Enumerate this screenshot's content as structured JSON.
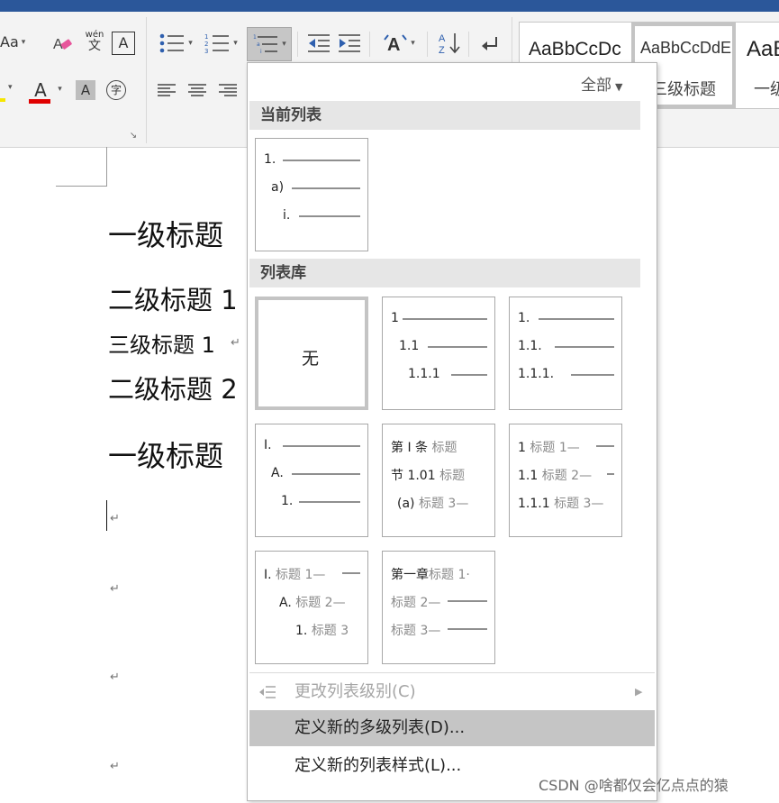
{
  "ribbon": {
    "font_case_label": "Aa",
    "phonetic_top": "wén",
    "phonetic_bottom": "文",
    "char_border_label": "A",
    "font_color_label": "A",
    "char_shading_label": "A",
    "enclose_char_label": "字",
    "dialog_launcher": "↘",
    "styles": [
      {
        "sample": "AaBbCcDc",
        "name": ""
      },
      {
        "sample": "AaBbCcDdE",
        "name": "三级标题"
      },
      {
        "sample": "AaB",
        "name": "一级"
      }
    ]
  },
  "document": {
    "headings": [
      "一级标题",
      "二级标题 1",
      "三级标题 1",
      "二级标题 2",
      "一级标题"
    ],
    "para_mark": "↵"
  },
  "dropdown": {
    "filter_label": "全部",
    "current_list_header": "当前列表",
    "library_header": "列表库",
    "current_list": [
      "1.",
      "a)",
      "i."
    ],
    "none_label": "无",
    "lib": {
      "t2": [
        "1",
        "1.1",
        "1.1.1"
      ],
      "t3": [
        "1.",
        "1.1.",
        "1.1.1."
      ],
      "t4": [
        "I.",
        "A.",
        "1."
      ],
      "t5": [
        {
          "prefix": "第 Ⅰ 条",
          "text": "标题"
        },
        {
          "prefix": "节 1.01",
          "text": "标题"
        },
        {
          "prefix": "(a)",
          "text": "标题 3—"
        }
      ],
      "t6": [
        {
          "prefix": "1",
          "text": "标题 1—"
        },
        {
          "prefix": "1.1",
          "text": "标题 2—"
        },
        {
          "prefix": "1.1.1",
          "text": "标题 3—"
        }
      ],
      "t7": [
        {
          "prefix": "I.",
          "text": "标题 1—"
        },
        {
          "prefix": "A.",
          "text": "标题 2—"
        },
        {
          "prefix": "1.",
          "text": "标题 3"
        }
      ],
      "t8": [
        {
          "prefix": "第一章",
          "text": "标题 1·"
        },
        {
          "prefix": "",
          "text": "标题 2—"
        },
        {
          "prefix": "",
          "text": "标题 3—"
        }
      ]
    },
    "menu": {
      "change_level": "更改列表级别(C)",
      "define_multilevel": "定义新的多级列表(D)...",
      "define_style": "定义新的列表样式(L)..."
    }
  },
  "watermark": "CSDN @啥都仅会亿点点的猿",
  "colors": {
    "title_bar": "#2b579a",
    "font_color_bar": "#e00000",
    "highlight_bar": "#f6e600",
    "menu_highlight": "#c5c5c5"
  }
}
